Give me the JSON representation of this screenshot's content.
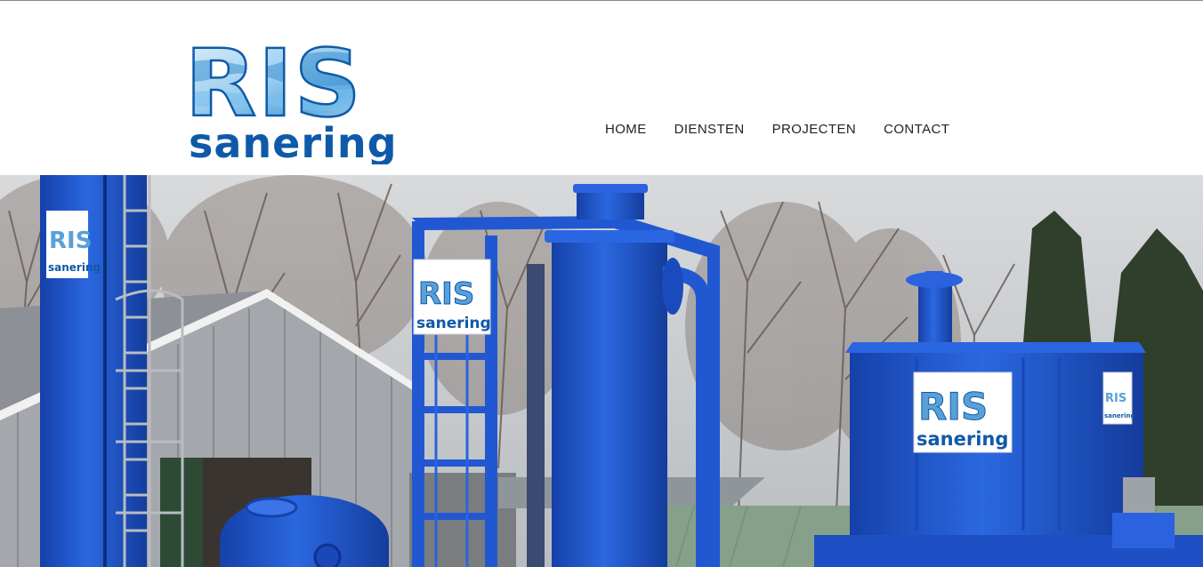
{
  "brand": {
    "logo_top": "RIS",
    "logo_bottom": "sanering",
    "primary_color": "#0f5aa8",
    "logo_water_color": "#6eb4e6"
  },
  "nav": {
    "items": [
      {
        "label": "HOME"
      },
      {
        "label": "DIENSTEN"
      },
      {
        "label": "PROJECTEN"
      },
      {
        "label": "CONTACT"
      }
    ]
  },
  "hero": {
    "sign_top": "RIS",
    "sign_bottom": "sanering",
    "equipment_color": "#1f55c9",
    "sky_color": "#c9cdd0"
  }
}
